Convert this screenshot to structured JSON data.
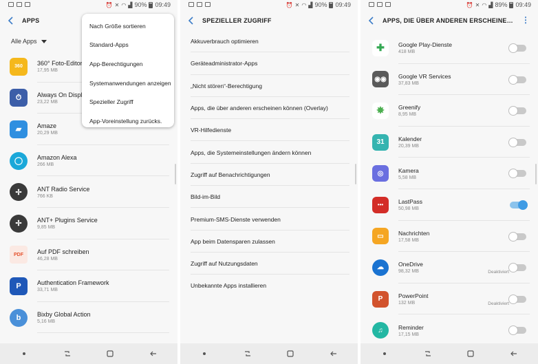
{
  "status": {
    "battery_1": "90%",
    "time_1": "09:49",
    "battery_2": "90%",
    "time_2": "09:49",
    "battery_3": "89%",
    "time_3": "09:49"
  },
  "screen1": {
    "title": "APPS",
    "filter": "Alle Apps",
    "menu": [
      "Nach Größe sortieren",
      "Standard-Apps",
      "App-Berechtigungen",
      "Systemanwendungen anzeigen",
      "Spezieller Zugriff",
      "App-Voreinstellung zurücks."
    ],
    "apps": [
      {
        "name": "360° Foto-Editor",
        "size": "17,95 MB",
        "icon": "360-photo-icon",
        "color": "#f5b81c",
        "glyph": "360"
      },
      {
        "name": "Always On Display",
        "size": "23,22 MB",
        "icon": "always-on-display-icon",
        "color": "#3c5ea8",
        "glyph": "⏱"
      },
      {
        "name": "Amaze",
        "size": "20,29 MB",
        "icon": "amaze-folder-icon",
        "color": "#2f8fe0",
        "glyph": "▰"
      },
      {
        "name": "Amazon Alexa",
        "size": "266 MB",
        "icon": "alexa-icon",
        "color": "#1ba8d9",
        "glyph": "◯"
      },
      {
        "name": "ANT Radio Service",
        "size": "766 KB",
        "icon": "ant-radio-icon",
        "color": "#3a3a3a",
        "glyph": "✢"
      },
      {
        "name": "ANT+ Plugins Service",
        "size": "9,85 MB",
        "icon": "ant-plus-icon",
        "color": "#3a3a3a",
        "glyph": "✢"
      },
      {
        "name": "Auf PDF schreiben",
        "size": "46,28 MB",
        "icon": "pdf-icon",
        "color": "#fbe9e3",
        "glyph": "PDF"
      },
      {
        "name": "Authentication Framework",
        "size": "33,71 MB",
        "icon": "authentication-icon",
        "color": "#1f58b8",
        "glyph": "P"
      },
      {
        "name": "Bixby Global Action",
        "size": "5,16 MB",
        "icon": "bixby-icon",
        "color": "#4a90d9",
        "glyph": "b"
      }
    ]
  },
  "screen2": {
    "title": "SPEZIELLER ZUGRIFF",
    "items": [
      "Akkuverbrauch optimieren",
      "Geräteadministrator-Apps",
      "„Nicht stören“-Berechtigung",
      "Apps, die über anderen erscheinen können (Overlay)",
      "VR-Hilfedienste",
      "Apps, die Systemeinstellungen ändern können",
      "Zugriff auf Benachrichtigungen",
      "Bild-im-Bild",
      "Premium-SMS-Dienste verwenden",
      "App beim Datensparen zulassen",
      "Zugriff auf Nutzungsdaten",
      "Unbekannte Apps installieren"
    ]
  },
  "screen3": {
    "title": "APPS, DIE ÜBER ANDEREN ERSCHEINEN KÖNNEN (OVE...",
    "apps": [
      {
        "name": "Google Play-Dienste",
        "size": "418 MB",
        "icon": "google-play-services-icon",
        "color": "#ffffff",
        "glyph": "✚",
        "glyph_color": "#34a853",
        "round": false,
        "on": false,
        "status": ""
      },
      {
        "name": "Google VR Services",
        "size": "37,83 MB",
        "icon": "google-vr-icon",
        "color": "#5a5a5a",
        "glyph": "◉◉",
        "glyph_color": "#ffffff",
        "round": false,
        "on": false,
        "status": ""
      },
      {
        "name": "Greenify",
        "size": "8,95 MB",
        "icon": "greenify-leaf-icon",
        "color": "#ffffff",
        "glyph": "✸",
        "glyph_color": "#4caf50",
        "round": false,
        "on": false,
        "status": ""
      },
      {
        "name": "Kalender",
        "size": "20,39 MB",
        "icon": "calendar-icon",
        "color": "#35b4b0",
        "glyph": "31",
        "glyph_color": "#ffffff",
        "round": false,
        "on": false,
        "status": ""
      },
      {
        "name": "Kamera",
        "size": "5,58 MB",
        "icon": "camera-icon",
        "color": "#6a6fe0",
        "glyph": "◎",
        "glyph_color": "#ffffff",
        "round": false,
        "on": false,
        "status": ""
      },
      {
        "name": "LastPass",
        "size": "50,98 MB",
        "icon": "lastpass-icon",
        "color": "#d32d27",
        "glyph": "•••",
        "glyph_color": "#ffffff",
        "round": false,
        "on": true,
        "status": ""
      },
      {
        "name": "Nachrichten",
        "size": "17,58 MB",
        "icon": "messages-icon",
        "color": "#f5a623",
        "glyph": "▭",
        "glyph_color": "#ffffff",
        "round": false,
        "on": false,
        "status": ""
      },
      {
        "name": "OneDrive",
        "size": "98,32 MB",
        "icon": "onedrive-cloud-icon",
        "color": "#1a73d1",
        "glyph": "☁",
        "glyph_color": "#ffffff",
        "round": true,
        "on": false,
        "status": "Deaktiviert"
      },
      {
        "name": "PowerPoint",
        "size": "132 MB",
        "icon": "powerpoint-icon",
        "color": "#d2532d",
        "glyph": "P",
        "glyph_color": "#ffffff",
        "round": false,
        "on": false,
        "status": "Deaktiviert"
      },
      {
        "name": "Reminder",
        "size": "17,15 MB",
        "icon": "reminder-bell-icon",
        "color": "#23b7a3",
        "glyph": "♫",
        "glyph_color": "#ffffff",
        "round": true,
        "on": false,
        "status": ""
      }
    ]
  }
}
